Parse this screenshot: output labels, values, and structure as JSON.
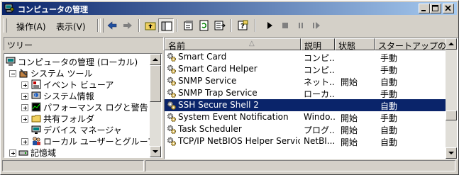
{
  "window": {
    "title": "コンピュータの管理"
  },
  "menu": {
    "action": "操作(A)",
    "view": "表示(V)"
  },
  "tree_pane": {
    "tab_label": "ツリー",
    "nodes": [
      {
        "label": "コンピュータの管理 (ローカル)",
        "icon": "computer-icon"
      },
      {
        "label": "システム ツール",
        "icon": "tools-icon"
      },
      {
        "label": "イベント ビューア",
        "icon": "event-viewer-icon"
      },
      {
        "label": "システム情報",
        "icon": "system-info-icon"
      },
      {
        "label": "パフォーマンス ログと警告",
        "icon": "performance-icon"
      },
      {
        "label": "共有フォルダ",
        "icon": "folder-icon"
      },
      {
        "label": "デバイス マネージャ",
        "icon": "device-manager-icon"
      },
      {
        "label": "ローカル ユーザーとグループ",
        "icon": "users-icon"
      },
      {
        "label": "記憶域",
        "icon": "storage-icon"
      }
    ]
  },
  "services": {
    "columns": [
      "名前",
      "説明",
      "状態",
      "スタートアップの種類"
    ],
    "sort_glyph": "△",
    "rows": [
      {
        "name": "Smart Card",
        "desc": "コンピ...",
        "status": "",
        "startup": "手動"
      },
      {
        "name": "Smart Card Helper",
        "desc": "コンピ...",
        "status": "",
        "startup": "手動"
      },
      {
        "name": "SNMP Service",
        "desc": "ネット...",
        "status": "開始",
        "startup": "自動"
      },
      {
        "name": "SNMP Trap Service",
        "desc": "ローカ...",
        "status": "",
        "startup": "手動"
      },
      {
        "name": "SSH Secure Shell 2",
        "desc": "",
        "status": "",
        "startup": "自動",
        "selected": true
      },
      {
        "name": "System Event Notification",
        "desc": "Windo...",
        "status": "開始",
        "startup": "手動"
      },
      {
        "name": "Task Scheduler",
        "desc": "プログ...",
        "status": "開始",
        "startup": "自動"
      },
      {
        "name": "TCP/IP NetBIOS Helper Service",
        "desc": "NetBI...",
        "status": "開始",
        "startup": "自動"
      }
    ]
  },
  "colors": {
    "selection": "#0a246a",
    "titlebar": "#0a246a"
  }
}
